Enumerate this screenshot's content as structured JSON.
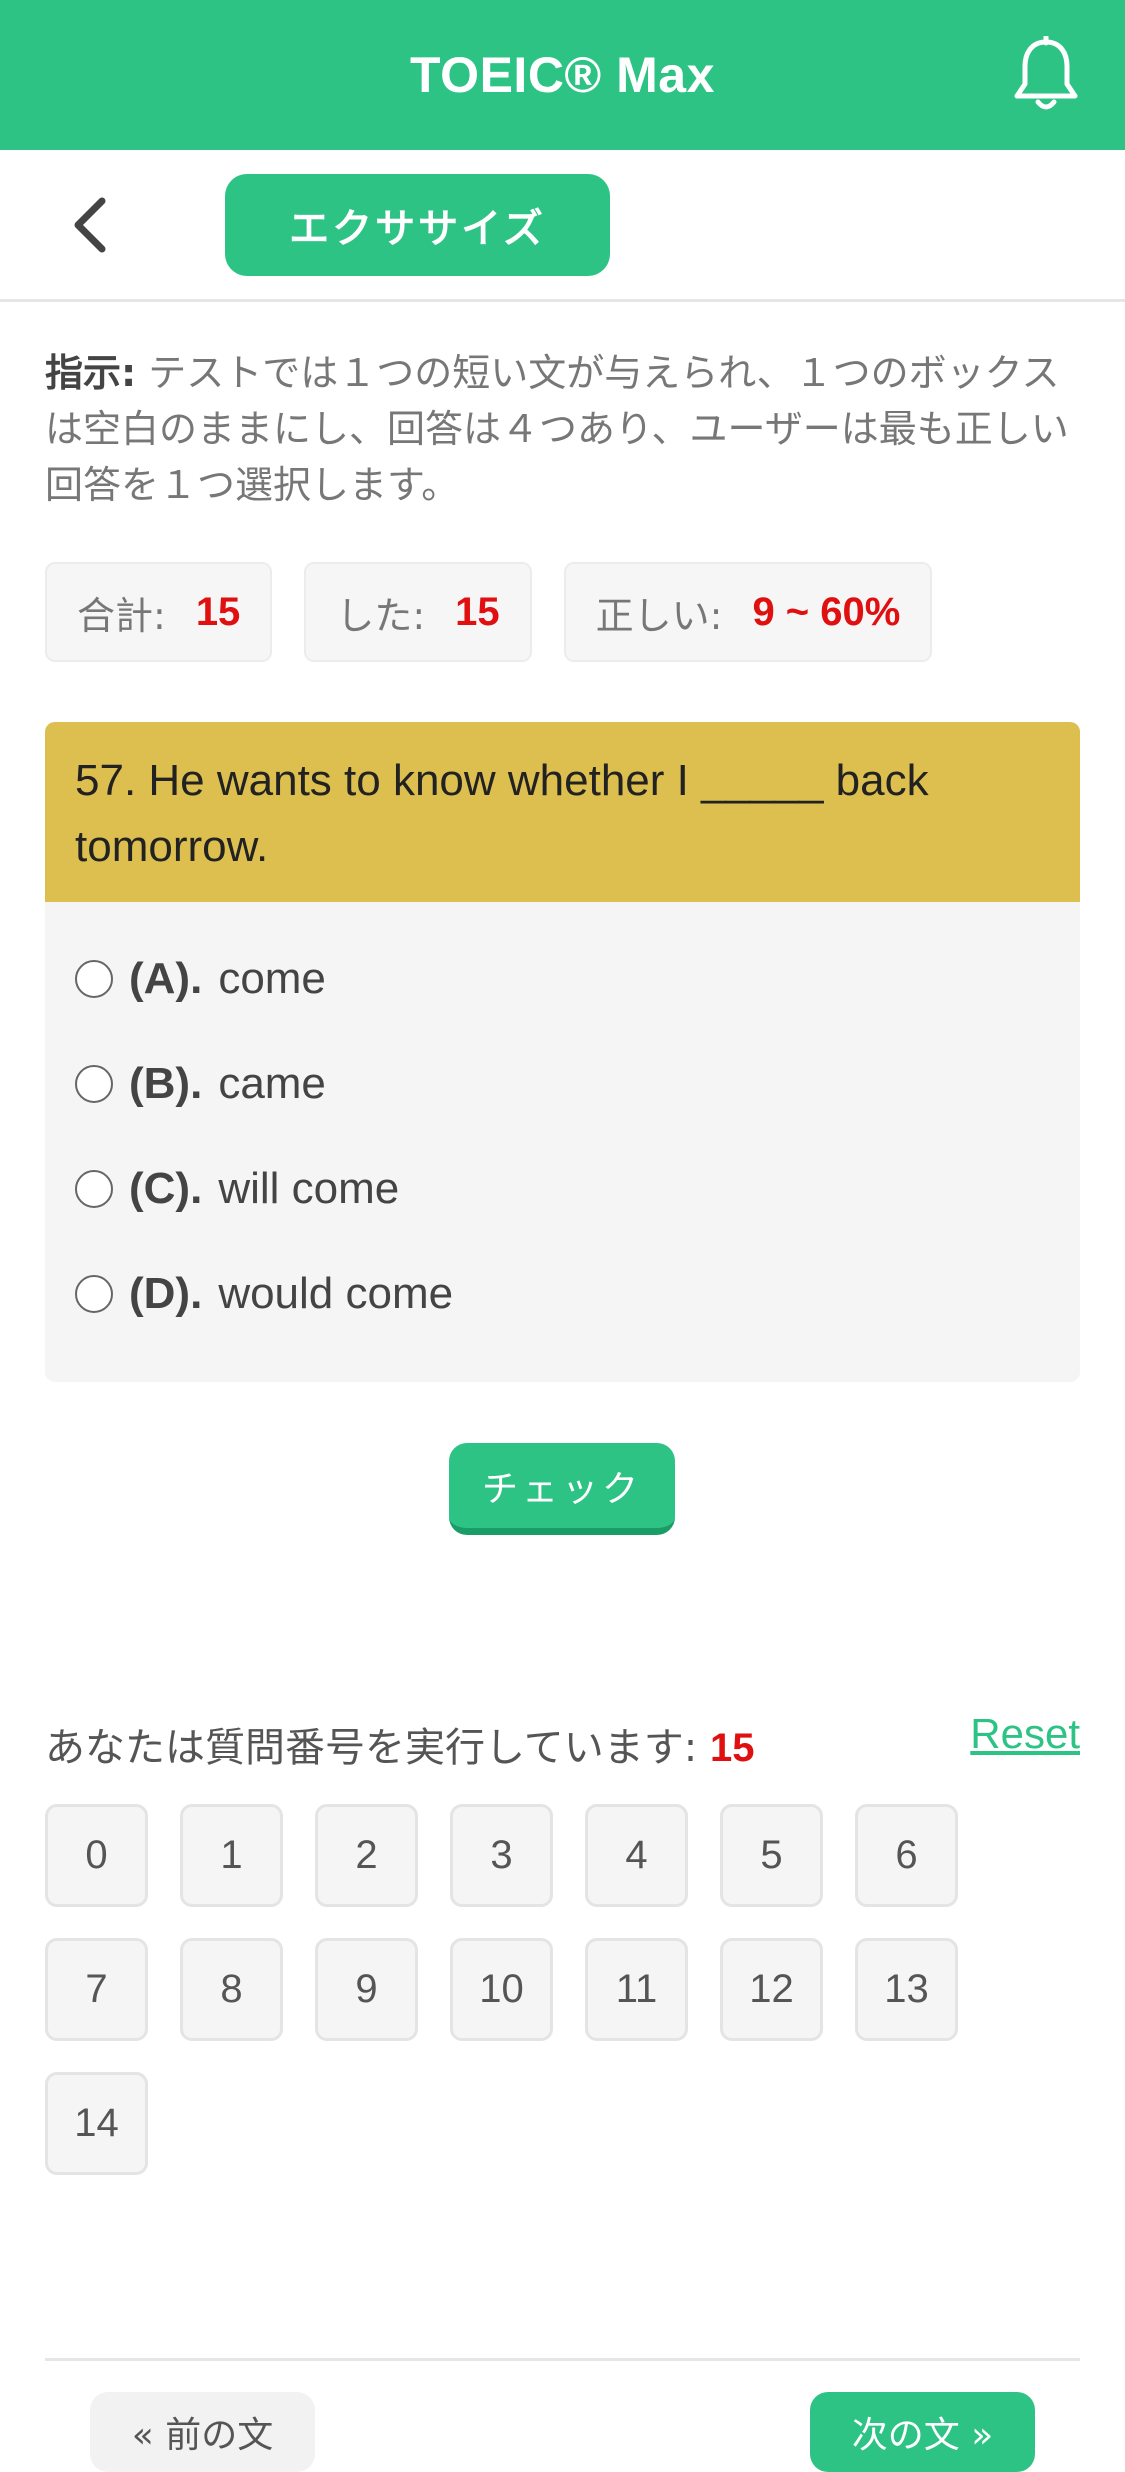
{
  "header": {
    "title": "TOEIC® Max",
    "bell_icon": "bell-icon"
  },
  "toolbar": {
    "back_icon": "chevron-left-icon",
    "tab_label": "エクササイズ"
  },
  "instructions": {
    "label": "指示:",
    "text": " テストでは１つの短い文が与えられ、１つのボックスは空白のままにし、回答は４つあり、ユーザーは最も正しい回答を１つ選択します。"
  },
  "stats": [
    {
      "label": "合計:",
      "value": "15"
    },
    {
      "label": "した:",
      "value": "15"
    },
    {
      "label": "正しい:",
      "value": "9 ~ 60%"
    }
  ],
  "question": {
    "text": "57. He wants to know whether I _____ back tomorrow.",
    "options": [
      {
        "letter": "(A).",
        "text": "come"
      },
      {
        "letter": "(B).",
        "text": "came"
      },
      {
        "letter": "(C).",
        "text": "will come"
      },
      {
        "letter": "(D).",
        "text": "would come"
      }
    ],
    "colors": {
      "header_bg": "#dcbf4f"
    }
  },
  "check_label": "チェック",
  "progress": {
    "label": "あなたは質問番号を実行しています:",
    "current": "15",
    "reset_label": "Reset",
    "numbers": [
      "0",
      "1",
      "2",
      "3",
      "4",
      "5",
      "6",
      "7",
      "8",
      "9",
      "10",
      "11",
      "12",
      "13",
      "14"
    ]
  },
  "nav": {
    "prev_label": "« 前の文",
    "next_label": "次の文 »"
  },
  "colors": {
    "accent": "#2dc385",
    "highlight_red": "#e01010"
  }
}
